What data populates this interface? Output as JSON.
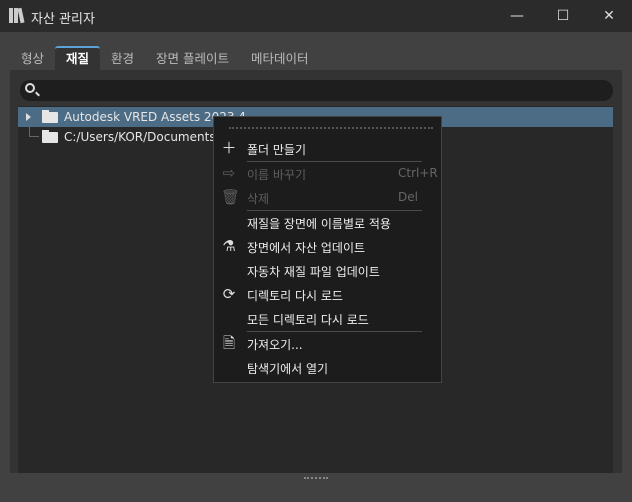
{
  "window": {
    "title": "자산 관리자",
    "minimize": "—",
    "maximize": "☐",
    "close": "✕"
  },
  "tabs": [
    {
      "label": "형상"
    },
    {
      "label": "재질",
      "active": true
    },
    {
      "label": "환경"
    },
    {
      "label": "장면 플레이트"
    },
    {
      "label": "메타데이터"
    }
  ],
  "search": {
    "value": "",
    "placeholder": ""
  },
  "tree": [
    {
      "label": "Autodesk VRED Assets 2023.4",
      "selected": true
    },
    {
      "label": "C:/Users/KOR/Documents/A"
    }
  ],
  "context_menu": [
    {
      "label": "폴더 만들기",
      "icon": "plus-icon",
      "shortcut": ""
    },
    {
      "label": "이름 바꾸기",
      "icon": "rename-icon",
      "shortcut": "Ctrl+R",
      "disabled": true
    },
    {
      "label": "삭제",
      "icon": "trash-icon",
      "shortcut": "Del",
      "disabled": true
    },
    {
      "label": "재질을 장면에 이름별로 적용"
    },
    {
      "label": "장면에서 자산 업데이트",
      "icon": "update-assets-icon"
    },
    {
      "label": "자동차 재질 파일 업데이트"
    },
    {
      "label": "디렉토리 다시 로드",
      "icon": "reload-icon"
    },
    {
      "label": "모든 디렉토리 다시 로드"
    },
    {
      "label": "가져오기...",
      "icon": "import-icon"
    },
    {
      "label": "탐색기에서 열기"
    }
  ]
}
